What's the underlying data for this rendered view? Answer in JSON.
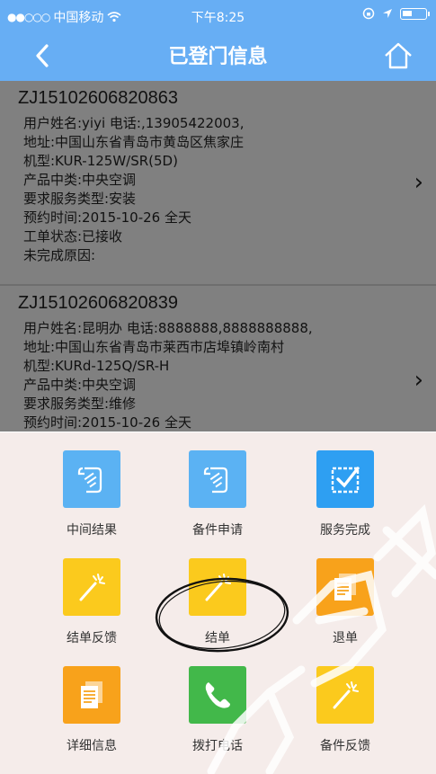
{
  "status_bar": {
    "carrier": "中国移动",
    "time": "下午8:25"
  },
  "nav": {
    "title": "已登门信息"
  },
  "orders": [
    {
      "id": "ZJ15102606820863",
      "lines": [
        "用户姓名:yiyi  电话:,13905422003,",
        "地址:中国山东省青岛市黄岛区焦家庄",
        "机型:KUR-125W/SR(5D)",
        "产品中类:中央空调",
        "要求服务类型:安装",
        "预约时间:2015-10-26 全天",
        "工单状态:已接收",
        "未完成原因:"
      ]
    },
    {
      "id": "ZJ15102606820839",
      "lines": [
        "用户姓名:昆明办  电话:8888888,8888888888,",
        "地址:中国山东省青岛市莱西市店埠镇岭南村",
        "机型:KURd-125Q/SR-H",
        "产品中类:中央空调",
        "要求服务类型:维修",
        "预约时间:2015-10-26 全天"
      ]
    }
  ],
  "actions": [
    {
      "label": "中间结果",
      "icon": "document-scroll-icon",
      "color": "#5bb2f3"
    },
    {
      "label": "备件申请",
      "icon": "document-scroll-icon",
      "color": "#5bb2f3"
    },
    {
      "label": "服务完成",
      "icon": "checkbox-icon",
      "color": "#2e9ff2"
    },
    {
      "label": "结单反馈",
      "icon": "magic-wand-icon",
      "color": "#fbca1d"
    },
    {
      "label": "结单",
      "icon": "magic-wand-icon",
      "color": "#fbca1d"
    },
    {
      "label": "退单",
      "icon": "documents-icon",
      "color": "#f8a21b"
    },
    {
      "label": "详细信息",
      "icon": "documents-icon",
      "color": "#f8a21b"
    },
    {
      "label": "拨打电话",
      "icon": "phone-icon",
      "color": "#42b84a"
    },
    {
      "label": "备件反馈",
      "icon": "magic-wand-icon",
      "color": "#fbca1d"
    }
  ]
}
